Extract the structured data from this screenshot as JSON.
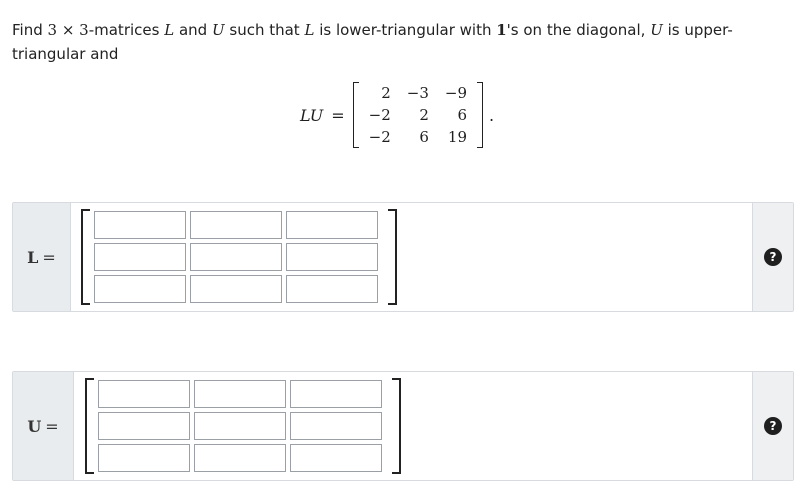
{
  "prompt": {
    "find": "Find ",
    "dim_a": "3",
    "times": " × ",
    "dim_b": "3",
    "text1": "-matrices ",
    "var_L": "L",
    "and1": " and ",
    "var_U": "U",
    "text2": " such that ",
    "var_L2": "L",
    "text3": " is lower-triangular with ",
    "one": "1",
    "text4": "'s on the diagonal, ",
    "var_U2": "U",
    "text5": " is upper-triangular and"
  },
  "equation": {
    "lhs": "LU",
    "sign": "=",
    "matrix": [
      [
        "2",
        "−3",
        "−9"
      ],
      [
        "−2",
        "2",
        "6"
      ],
      [
        "−2",
        "6",
        "19"
      ]
    ],
    "period": "."
  },
  "answers": {
    "L": {
      "label": "L",
      "eq": "=",
      "cells": [
        "",
        "",
        "",
        "",
        "",
        "",
        "",
        "",
        ""
      ]
    },
    "U": {
      "label": "U",
      "eq": "=",
      "cells": [
        "",
        "",
        "",
        "",
        "",
        "",
        "",
        "",
        ""
      ]
    }
  },
  "help": {
    "icon": "question-circle-icon",
    "glyph": "?"
  }
}
